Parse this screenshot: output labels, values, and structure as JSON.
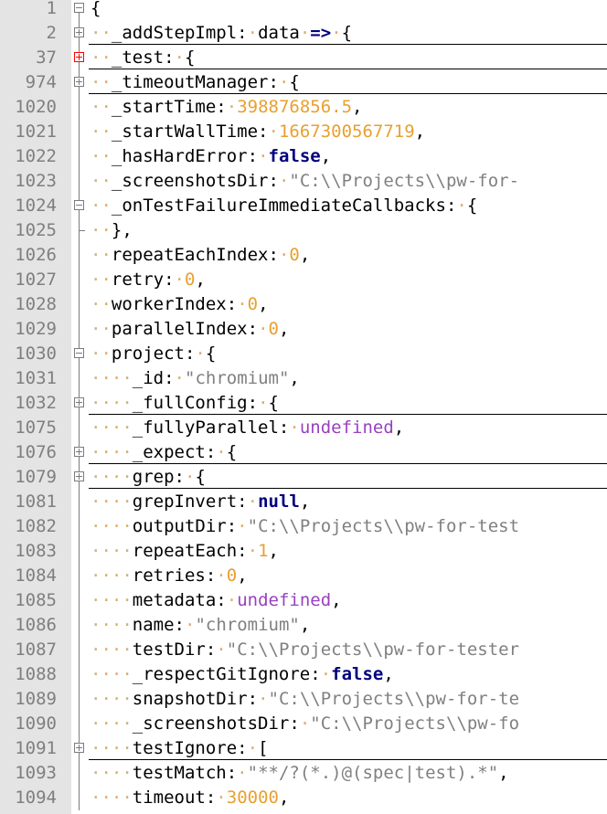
{
  "editor": {
    "lines": [
      {
        "num": "1",
        "fold": "minus",
        "level": 0,
        "tokens": [
          {
            "t": "{",
            "c": "p"
          }
        ]
      },
      {
        "num": "2",
        "fold": "plus",
        "level": 1,
        "tokens": [
          {
            "t": "_addStepImpl",
            "c": "p"
          },
          {
            "t": ":",
            "c": "p"
          },
          {
            "t": " ",
            "c": "ws"
          },
          {
            "t": "data",
            "c": "p"
          },
          {
            "t": " ",
            "c": "ws"
          },
          {
            "t": "=>",
            "c": "kw"
          },
          {
            "t": " ",
            "c": "ws"
          },
          {
            "t": "{",
            "c": "p"
          }
        ]
      },
      {
        "num": "37",
        "fold": "plus-error",
        "level": 1,
        "tokens": [
          {
            "t": "_test",
            "c": "p"
          },
          {
            "t": ":",
            "c": "p"
          },
          {
            "t": " ",
            "c": "ws"
          },
          {
            "t": "{",
            "c": "p"
          }
        ]
      },
      {
        "num": "974",
        "fold": "plus",
        "level": 1,
        "tokens": [
          {
            "t": "_timeoutManager",
            "c": "p"
          },
          {
            "t": ":",
            "c": "p"
          },
          {
            "t": " ",
            "c": "ws"
          },
          {
            "t": "{",
            "c": "p"
          }
        ]
      },
      {
        "num": "1020",
        "fold": "line",
        "level": 1,
        "tokens": [
          {
            "t": "_startTime",
            "c": "p"
          },
          {
            "t": ":",
            "c": "p"
          },
          {
            "t": " ",
            "c": "ws"
          },
          {
            "t": "398876856.5",
            "c": "num"
          },
          {
            "t": ",",
            "c": "p"
          }
        ]
      },
      {
        "num": "1021",
        "fold": "line",
        "level": 1,
        "tokens": [
          {
            "t": "_startWallTime",
            "c": "p"
          },
          {
            "t": ":",
            "c": "p"
          },
          {
            "t": " ",
            "c": "ws"
          },
          {
            "t": "1667300567719",
            "c": "num"
          },
          {
            "t": ",",
            "c": "p"
          }
        ]
      },
      {
        "num": "1022",
        "fold": "line",
        "level": 1,
        "tokens": [
          {
            "t": "_hasHardError",
            "c": "p"
          },
          {
            "t": ":",
            "c": "p"
          },
          {
            "t": " ",
            "c": "ws"
          },
          {
            "t": "false",
            "c": "kw"
          },
          {
            "t": ",",
            "c": "p"
          }
        ]
      },
      {
        "num": "1023",
        "fold": "line",
        "level": 1,
        "tokens": [
          {
            "t": "_screenshotsDir",
            "c": "p"
          },
          {
            "t": ":",
            "c": "p"
          },
          {
            "t": " ",
            "c": "ws"
          },
          {
            "t": "\"C:\\\\Projects\\\\pw-for-",
            "c": "str"
          }
        ]
      },
      {
        "num": "1024",
        "fold": "minus",
        "level": 1,
        "tokens": [
          {
            "t": "_onTestFailureImmediateCallbacks",
            "c": "p"
          },
          {
            "t": ":",
            "c": "p"
          },
          {
            "t": " ",
            "c": "ws"
          },
          {
            "t": "{",
            "c": "p"
          }
        ]
      },
      {
        "num": "1025",
        "fold": "end",
        "level": 1,
        "tokens": [
          {
            "t": "},",
            "c": "p"
          }
        ]
      },
      {
        "num": "1026",
        "fold": "line",
        "level": 1,
        "tokens": [
          {
            "t": "repeatEachIndex",
            "c": "p"
          },
          {
            "t": ":",
            "c": "p"
          },
          {
            "t": " ",
            "c": "ws"
          },
          {
            "t": "0",
            "c": "num"
          },
          {
            "t": ",",
            "c": "p"
          }
        ]
      },
      {
        "num": "1027",
        "fold": "line",
        "level": 1,
        "tokens": [
          {
            "t": "retry",
            "c": "p"
          },
          {
            "t": ":",
            "c": "p"
          },
          {
            "t": " ",
            "c": "ws"
          },
          {
            "t": "0",
            "c": "num"
          },
          {
            "t": ",",
            "c": "p"
          }
        ]
      },
      {
        "num": "1028",
        "fold": "line",
        "level": 1,
        "tokens": [
          {
            "t": "workerIndex",
            "c": "p"
          },
          {
            "t": ":",
            "c": "p"
          },
          {
            "t": " ",
            "c": "ws"
          },
          {
            "t": "0",
            "c": "num"
          },
          {
            "t": ",",
            "c": "p"
          }
        ]
      },
      {
        "num": "1029",
        "fold": "line",
        "level": 1,
        "tokens": [
          {
            "t": "parallelIndex",
            "c": "p"
          },
          {
            "t": ":",
            "c": "p"
          },
          {
            "t": " ",
            "c": "ws"
          },
          {
            "t": "0",
            "c": "num"
          },
          {
            "t": ",",
            "c": "p"
          }
        ]
      },
      {
        "num": "1030",
        "fold": "minus",
        "level": 1,
        "tokens": [
          {
            "t": "project",
            "c": "p"
          },
          {
            "t": ":",
            "c": "p"
          },
          {
            "t": " ",
            "c": "ws"
          },
          {
            "t": "{",
            "c": "p"
          }
        ]
      },
      {
        "num": "1031",
        "fold": "line",
        "level": 2,
        "tokens": [
          {
            "t": "_id",
            "c": "p"
          },
          {
            "t": ":",
            "c": "p"
          },
          {
            "t": " ",
            "c": "ws"
          },
          {
            "t": "\"chromium\"",
            "c": "str"
          },
          {
            "t": ",",
            "c": "p"
          }
        ]
      },
      {
        "num": "1032",
        "fold": "plus",
        "level": 2,
        "tokens": [
          {
            "t": "_fullConfig",
            "c": "p"
          },
          {
            "t": ":",
            "c": "p"
          },
          {
            "t": " ",
            "c": "ws"
          },
          {
            "t": "{",
            "c": "p"
          }
        ]
      },
      {
        "num": "1075",
        "fold": "line",
        "level": 2,
        "tokens": [
          {
            "t": "_fullyParallel",
            "c": "p"
          },
          {
            "t": ":",
            "c": "p"
          },
          {
            "t": " ",
            "c": "ws"
          },
          {
            "t": "undefined",
            "c": "und"
          },
          {
            "t": ",",
            "c": "p"
          }
        ]
      },
      {
        "num": "1076",
        "fold": "plus",
        "level": 2,
        "tokens": [
          {
            "t": "_expect",
            "c": "p"
          },
          {
            "t": ":",
            "c": "p"
          },
          {
            "t": " ",
            "c": "ws"
          },
          {
            "t": "{",
            "c": "p"
          }
        ]
      },
      {
        "num": "1079",
        "fold": "plus",
        "level": 2,
        "tokens": [
          {
            "t": "grep",
            "c": "p"
          },
          {
            "t": ":",
            "c": "p"
          },
          {
            "t": " ",
            "c": "ws"
          },
          {
            "t": "{",
            "c": "p"
          }
        ]
      },
      {
        "num": "1081",
        "fold": "line",
        "level": 2,
        "tokens": [
          {
            "t": "grepInvert",
            "c": "p"
          },
          {
            "t": ":",
            "c": "p"
          },
          {
            "t": " ",
            "c": "ws"
          },
          {
            "t": "null",
            "c": "kw"
          },
          {
            "t": ",",
            "c": "p"
          }
        ]
      },
      {
        "num": "1082",
        "fold": "line",
        "level": 2,
        "tokens": [
          {
            "t": "outputDir",
            "c": "p"
          },
          {
            "t": ":",
            "c": "p"
          },
          {
            "t": " ",
            "c": "ws"
          },
          {
            "t": "\"C:\\\\Projects\\\\pw-for-test",
            "c": "str"
          }
        ]
      },
      {
        "num": "1083",
        "fold": "line",
        "level": 2,
        "tokens": [
          {
            "t": "repeatEach",
            "c": "p"
          },
          {
            "t": ":",
            "c": "p"
          },
          {
            "t": " ",
            "c": "ws"
          },
          {
            "t": "1",
            "c": "num"
          },
          {
            "t": ",",
            "c": "p"
          }
        ]
      },
      {
        "num": "1084",
        "fold": "line",
        "level": 2,
        "tokens": [
          {
            "t": "retries",
            "c": "p"
          },
          {
            "t": ":",
            "c": "p"
          },
          {
            "t": " ",
            "c": "ws"
          },
          {
            "t": "0",
            "c": "num"
          },
          {
            "t": ",",
            "c": "p"
          }
        ]
      },
      {
        "num": "1085",
        "fold": "line",
        "level": 2,
        "tokens": [
          {
            "t": "metadata",
            "c": "p"
          },
          {
            "t": ":",
            "c": "p"
          },
          {
            "t": " ",
            "c": "ws"
          },
          {
            "t": "undefined",
            "c": "und"
          },
          {
            "t": ",",
            "c": "p"
          }
        ]
      },
      {
        "num": "1086",
        "fold": "line",
        "level": 2,
        "tokens": [
          {
            "t": "name",
            "c": "p"
          },
          {
            "t": ":",
            "c": "p"
          },
          {
            "t": " ",
            "c": "ws"
          },
          {
            "t": "\"chromium\"",
            "c": "str"
          },
          {
            "t": ",",
            "c": "p"
          }
        ]
      },
      {
        "num": "1087",
        "fold": "line",
        "level": 2,
        "tokens": [
          {
            "t": "testDir",
            "c": "p"
          },
          {
            "t": ":",
            "c": "p"
          },
          {
            "t": " ",
            "c": "ws"
          },
          {
            "t": "\"C:\\\\Projects\\\\pw-for-tester",
            "c": "str"
          }
        ]
      },
      {
        "num": "1088",
        "fold": "line",
        "level": 2,
        "tokens": [
          {
            "t": "_respectGitIgnore",
            "c": "p"
          },
          {
            "t": ":",
            "c": "p"
          },
          {
            "t": " ",
            "c": "ws"
          },
          {
            "t": "false",
            "c": "kw"
          },
          {
            "t": ",",
            "c": "p"
          }
        ]
      },
      {
        "num": "1089",
        "fold": "line",
        "level": 2,
        "tokens": [
          {
            "t": "snapshotDir",
            "c": "p"
          },
          {
            "t": ":",
            "c": "p"
          },
          {
            "t": " ",
            "c": "ws"
          },
          {
            "t": "\"C:\\\\Projects\\\\pw-for-te",
            "c": "str"
          }
        ]
      },
      {
        "num": "1090",
        "fold": "line",
        "level": 2,
        "tokens": [
          {
            "t": "_screenshotsDir",
            "c": "p"
          },
          {
            "t": ":",
            "c": "p"
          },
          {
            "t": " ",
            "c": "ws"
          },
          {
            "t": "\"C:\\\\Projects\\\\pw-fo",
            "c": "str"
          }
        ]
      },
      {
        "num": "1091",
        "fold": "plus",
        "level": 2,
        "tokens": [
          {
            "t": "testIgnore",
            "c": "p"
          },
          {
            "t": ":",
            "c": "p"
          },
          {
            "t": " ",
            "c": "ws"
          },
          {
            "t": "[",
            "c": "p"
          }
        ]
      },
      {
        "num": "1093",
        "fold": "line",
        "level": 2,
        "tokens": [
          {
            "t": "testMatch",
            "c": "p"
          },
          {
            "t": ":",
            "c": "p"
          },
          {
            "t": " ",
            "c": "ws"
          },
          {
            "t": "\"**/?(*.)@(spec|test).*\"",
            "c": "str"
          },
          {
            "t": ",",
            "c": "p"
          }
        ]
      },
      {
        "num": "1094",
        "fold": "line",
        "level": 2,
        "tokens": [
          {
            "t": "timeout",
            "c": "p"
          },
          {
            "t": ":",
            "c": "p"
          },
          {
            "t": " ",
            "c": "ws"
          },
          {
            "t": "30000",
            "c": "num"
          },
          {
            "t": ",",
            "c": "p"
          }
        ]
      }
    ]
  },
  "colors": {
    "keyword": "#00007f",
    "number": "#e8a030",
    "string": "#808080",
    "undefined": "#9a40c0",
    "whitespace_dot": "#d8b070",
    "error_fold": "#ff0000"
  }
}
